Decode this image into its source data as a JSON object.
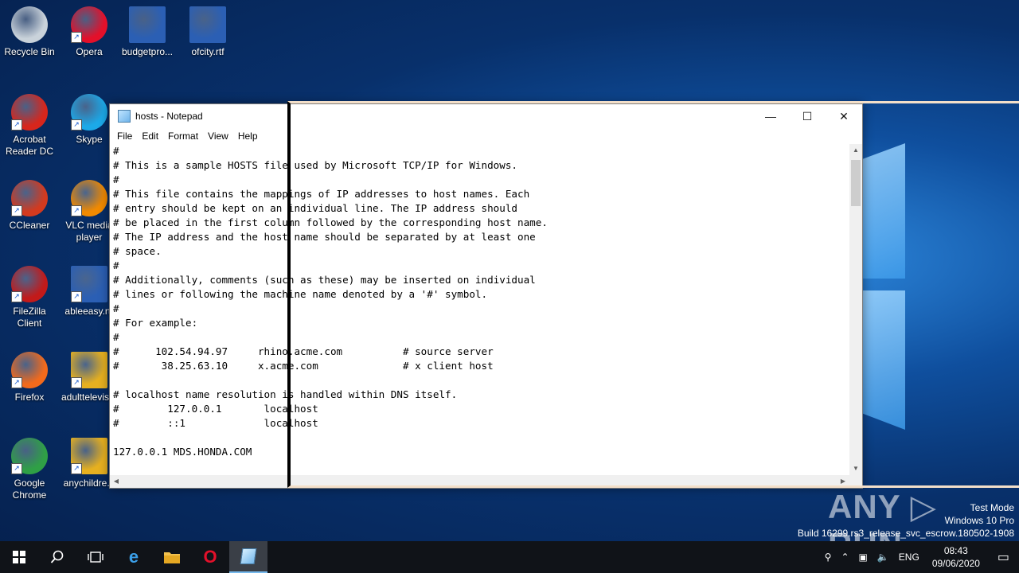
{
  "desktop": {
    "icons": [
      {
        "label": "Recycle Bin",
        "icon": "recycle-bin-icon",
        "color": "#c9d2da"
      },
      {
        "label": "Opera",
        "icon": "opera-icon",
        "color": "#e3102a"
      },
      {
        "label": "budgetpro...",
        "icon": "word-document-icon",
        "color": "#2b5fb4"
      },
      {
        "label": "ofcity.rtf",
        "icon": "word-document-icon",
        "color": "#2b5fb4"
      },
      {
        "label": "Acrobat Reader DC",
        "icon": "acrobat-icon",
        "color": "#d7261c"
      },
      {
        "label": "Skype",
        "icon": "skype-icon",
        "color": "#1ca9e8"
      },
      {
        "label": "CCleaner",
        "icon": "ccleaner-icon",
        "color": "#d33a1f"
      },
      {
        "label": "VLC media player",
        "icon": "vlc-icon",
        "color": "#f28a00"
      },
      {
        "label": "FileZilla Client",
        "icon": "filezilla-icon",
        "color": "#c21a1a"
      },
      {
        "label": "ableeasy.rtf",
        "icon": "word-document-icon",
        "color": "#2b5fb4"
      },
      {
        "label": "Firefox",
        "icon": "firefox-icon",
        "color": "#f26a1c"
      },
      {
        "label": "adulttelevis...",
        "icon": "image-file-icon",
        "color": "#e6b020"
      },
      {
        "label": "Google Chrome",
        "icon": "chrome-icon",
        "color": "#2fa046"
      },
      {
        "label": "anychildre...",
        "icon": "image-file-icon",
        "color": "#e6b020"
      }
    ]
  },
  "notepad": {
    "title": "hosts - Notepad",
    "menu": [
      "File",
      "Edit",
      "Format",
      "View",
      "Help"
    ],
    "controls": {
      "minimize": "—",
      "maximize": "☐",
      "close": "✕"
    },
    "text_lines": [
      "#",
      "# This is a sample HOSTS file used by Microsoft TCP/IP for Windows.",
      "#",
      "# This file contains the mappings of IP addresses to host names. Each",
      "# entry should be kept on an individual line. The IP address should",
      "# be placed in the first column followed by the corresponding host name.",
      "# The IP address and the host name should be separated by at least one",
      "# space.",
      "#",
      "# Additionally, comments (such as these) may be inserted on individual",
      "# lines or following the machine name denoted by a '#' symbol.",
      "#",
      "# For example:",
      "#",
      "#      102.54.94.97     rhino.acme.com          # source server",
      "#       38.25.63.10     x.acme.com              # x client host",
      "",
      "# localhost name resolution is handled within DNS itself.",
      "#\t127.0.0.1       localhost",
      "#\t::1             localhost",
      "",
      "127.0.0.1 MDS.HONDA.COM"
    ]
  },
  "watermark": {
    "text": "ANY ▷ RUN"
  },
  "system_info": {
    "line1": "Test Mode",
    "line2": "Windows 10 Pro",
    "line3": "Build 16299.rs3_release_svc_escrow.180502-1908"
  },
  "taskbar": {
    "language": "ENG",
    "time": "08:43",
    "date": "09/06/2020"
  }
}
